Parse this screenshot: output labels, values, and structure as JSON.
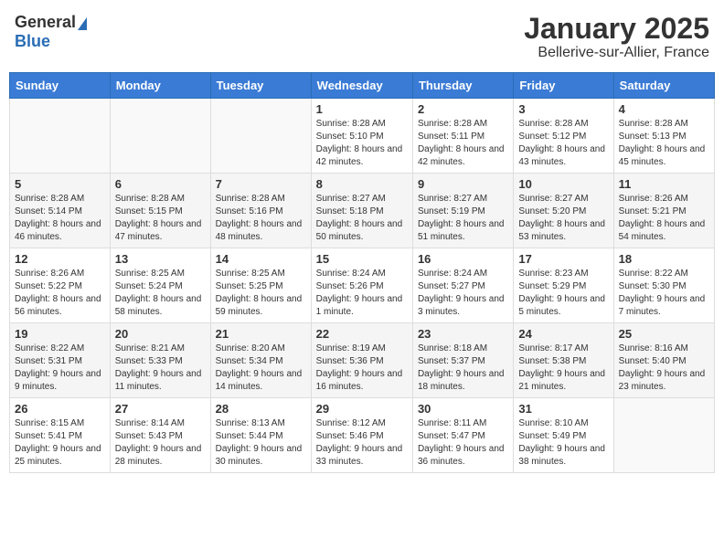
{
  "header": {
    "logo_general": "General",
    "logo_blue": "Blue",
    "title": "January 2025",
    "subtitle": "Bellerive-sur-Allier, France"
  },
  "weekdays": [
    "Sunday",
    "Monday",
    "Tuesday",
    "Wednesday",
    "Thursday",
    "Friday",
    "Saturday"
  ],
  "weeks": [
    [
      {
        "day": "",
        "info": ""
      },
      {
        "day": "",
        "info": ""
      },
      {
        "day": "",
        "info": ""
      },
      {
        "day": "1",
        "info": "Sunrise: 8:28 AM\nSunset: 5:10 PM\nDaylight: 8 hours and 42 minutes."
      },
      {
        "day": "2",
        "info": "Sunrise: 8:28 AM\nSunset: 5:11 PM\nDaylight: 8 hours and 42 minutes."
      },
      {
        "day": "3",
        "info": "Sunrise: 8:28 AM\nSunset: 5:12 PM\nDaylight: 8 hours and 43 minutes."
      },
      {
        "day": "4",
        "info": "Sunrise: 8:28 AM\nSunset: 5:13 PM\nDaylight: 8 hours and 45 minutes."
      }
    ],
    [
      {
        "day": "5",
        "info": "Sunrise: 8:28 AM\nSunset: 5:14 PM\nDaylight: 8 hours and 46 minutes."
      },
      {
        "day": "6",
        "info": "Sunrise: 8:28 AM\nSunset: 5:15 PM\nDaylight: 8 hours and 47 minutes."
      },
      {
        "day": "7",
        "info": "Sunrise: 8:28 AM\nSunset: 5:16 PM\nDaylight: 8 hours and 48 minutes."
      },
      {
        "day": "8",
        "info": "Sunrise: 8:27 AM\nSunset: 5:18 PM\nDaylight: 8 hours and 50 minutes."
      },
      {
        "day": "9",
        "info": "Sunrise: 8:27 AM\nSunset: 5:19 PM\nDaylight: 8 hours and 51 minutes."
      },
      {
        "day": "10",
        "info": "Sunrise: 8:27 AM\nSunset: 5:20 PM\nDaylight: 8 hours and 53 minutes."
      },
      {
        "day": "11",
        "info": "Sunrise: 8:26 AM\nSunset: 5:21 PM\nDaylight: 8 hours and 54 minutes."
      }
    ],
    [
      {
        "day": "12",
        "info": "Sunrise: 8:26 AM\nSunset: 5:22 PM\nDaylight: 8 hours and 56 minutes."
      },
      {
        "day": "13",
        "info": "Sunrise: 8:25 AM\nSunset: 5:24 PM\nDaylight: 8 hours and 58 minutes."
      },
      {
        "day": "14",
        "info": "Sunrise: 8:25 AM\nSunset: 5:25 PM\nDaylight: 8 hours and 59 minutes."
      },
      {
        "day": "15",
        "info": "Sunrise: 8:24 AM\nSunset: 5:26 PM\nDaylight: 9 hours and 1 minute."
      },
      {
        "day": "16",
        "info": "Sunrise: 8:24 AM\nSunset: 5:27 PM\nDaylight: 9 hours and 3 minutes."
      },
      {
        "day": "17",
        "info": "Sunrise: 8:23 AM\nSunset: 5:29 PM\nDaylight: 9 hours and 5 minutes."
      },
      {
        "day": "18",
        "info": "Sunrise: 8:22 AM\nSunset: 5:30 PM\nDaylight: 9 hours and 7 minutes."
      }
    ],
    [
      {
        "day": "19",
        "info": "Sunrise: 8:22 AM\nSunset: 5:31 PM\nDaylight: 9 hours and 9 minutes."
      },
      {
        "day": "20",
        "info": "Sunrise: 8:21 AM\nSunset: 5:33 PM\nDaylight: 9 hours and 11 minutes."
      },
      {
        "day": "21",
        "info": "Sunrise: 8:20 AM\nSunset: 5:34 PM\nDaylight: 9 hours and 14 minutes."
      },
      {
        "day": "22",
        "info": "Sunrise: 8:19 AM\nSunset: 5:36 PM\nDaylight: 9 hours and 16 minutes."
      },
      {
        "day": "23",
        "info": "Sunrise: 8:18 AM\nSunset: 5:37 PM\nDaylight: 9 hours and 18 minutes."
      },
      {
        "day": "24",
        "info": "Sunrise: 8:17 AM\nSunset: 5:38 PM\nDaylight: 9 hours and 21 minutes."
      },
      {
        "day": "25",
        "info": "Sunrise: 8:16 AM\nSunset: 5:40 PM\nDaylight: 9 hours and 23 minutes."
      }
    ],
    [
      {
        "day": "26",
        "info": "Sunrise: 8:15 AM\nSunset: 5:41 PM\nDaylight: 9 hours and 25 minutes."
      },
      {
        "day": "27",
        "info": "Sunrise: 8:14 AM\nSunset: 5:43 PM\nDaylight: 9 hours and 28 minutes."
      },
      {
        "day": "28",
        "info": "Sunrise: 8:13 AM\nSunset: 5:44 PM\nDaylight: 9 hours and 30 minutes."
      },
      {
        "day": "29",
        "info": "Sunrise: 8:12 AM\nSunset: 5:46 PM\nDaylight: 9 hours and 33 minutes."
      },
      {
        "day": "30",
        "info": "Sunrise: 8:11 AM\nSunset: 5:47 PM\nDaylight: 9 hours and 36 minutes."
      },
      {
        "day": "31",
        "info": "Sunrise: 8:10 AM\nSunset: 5:49 PM\nDaylight: 9 hours and 38 minutes."
      },
      {
        "day": "",
        "info": ""
      }
    ]
  ]
}
